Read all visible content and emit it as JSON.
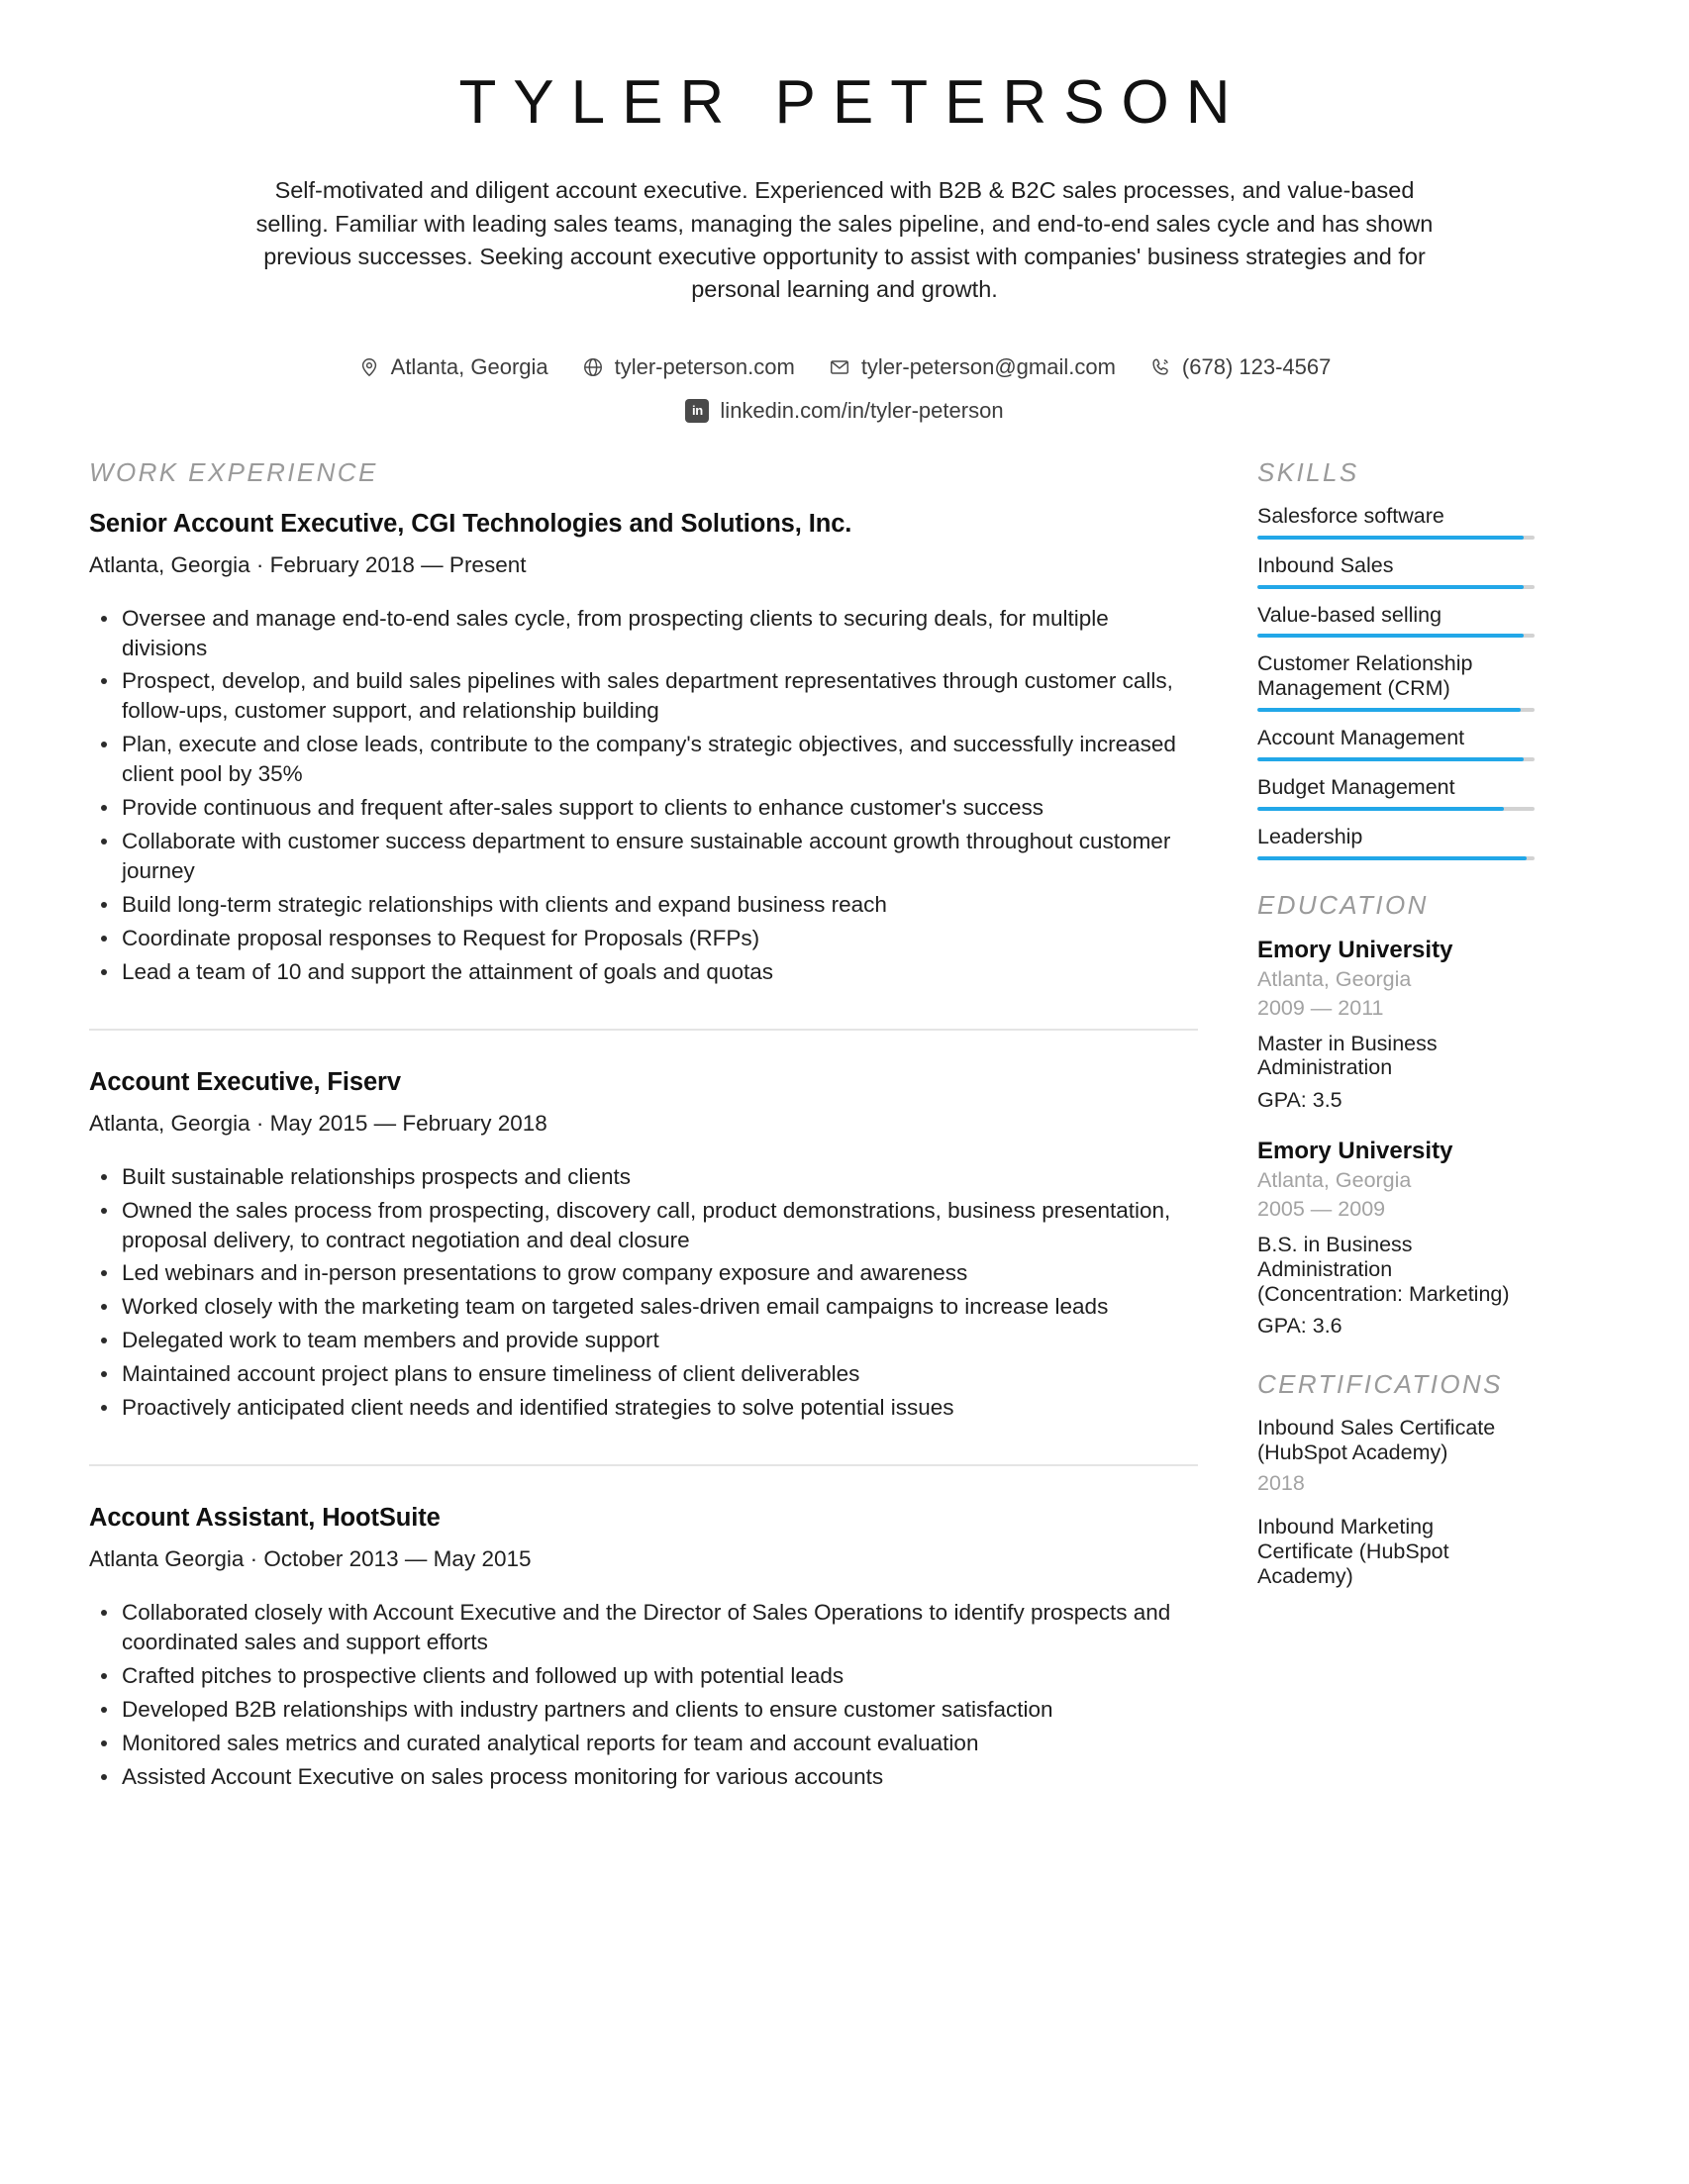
{
  "header": {
    "name": "TYLER PETERSON",
    "summary": "Self-motivated and diligent account executive. Experienced with B2B & B2C sales processes, and value-based selling. Familiar with leading sales teams, managing the sales pipeline, and end-to-end sales cycle and has shown previous successes. Seeking account executive opportunity to assist with companies' business strategies and for personal learning and growth.",
    "contacts": [
      {
        "icon": "location-pin-icon",
        "text": "Atlanta, Georgia"
      },
      {
        "icon": "globe-icon",
        "text": "tyler-peterson.com"
      },
      {
        "icon": "envelope-icon",
        "text": "tyler-peterson@gmail.com"
      },
      {
        "icon": "phone-icon",
        "text": "(678) 123-4567"
      }
    ],
    "linkedin": {
      "icon": "linkedin-icon",
      "badge": "in",
      "text": "linkedin.com/in/tyler-peterson"
    }
  },
  "sections": {
    "work_experience": "WORK EXPERIENCE",
    "skills": "SKILLS",
    "education": "EDUCATION",
    "certifications": "CERTIFICATIONS"
  },
  "jobs": [
    {
      "title": "Senior Account Executive, CGI Technologies and Solutions, Inc.",
      "meta": "Atlanta, Georgia · February 2018 — Present",
      "bullets": [
        "Oversee and manage end-to-end sales cycle, from prospecting clients to securing deals, for multiple divisions",
        "Prospect, develop, and build sales pipelines with sales department representatives through customer calls, follow-ups, customer support, and relationship building",
        "Plan, execute and close leads, contribute to the company's strategic objectives, and successfully increased client pool by 35%",
        "Provide continuous and frequent after-sales support to clients to enhance customer's success",
        "Collaborate with customer success department to ensure sustainable account growth throughout customer journey",
        "Build long-term strategic relationships with clients and expand business reach",
        "Coordinate proposal responses to Request for Proposals (RFPs)",
        "Lead a team of 10 and support the attainment of goals and quotas"
      ]
    },
    {
      "title": "Account Executive, Fiserv",
      "meta": "Atlanta, Georgia · May 2015 — February 2018",
      "bullets": [
        "Built sustainable relationships prospects and clients",
        "Owned the sales process from prospecting, discovery call, product demonstrations, business presentation, proposal delivery, to contract negotiation and deal closure",
        "Led webinars and in-person presentations to grow company exposure and awareness",
        "Worked closely with the marketing team on targeted sales-driven email campaigns to increase leads",
        "Delegated work to team members and provide support",
        "Maintained account project plans to ensure timeliness of client deliverables",
        "Proactively anticipated client needs and identified strategies to solve potential issues"
      ]
    },
    {
      "title": "Account Assistant, HootSuite",
      "meta": "Atlanta Georgia · October 2013 — May 2015",
      "bullets": [
        "Collaborated closely with Account Executive and the Director of Sales Operations to identify prospects and coordinated sales and support efforts",
        "Crafted pitches to prospective clients and followed up with potential leads",
        "Developed B2B relationships with industry partners and clients to ensure customer satisfaction",
        "Monitored sales metrics and curated analytical reports for team and account evaluation",
        "Assisted Account Executive on sales process monitoring for various accounts"
      ]
    }
  ],
  "skills": [
    {
      "label": "Salesforce software",
      "level": 96
    },
    {
      "label": "Inbound Sales",
      "level": 96
    },
    {
      "label": "Value-based selling",
      "level": 96
    },
    {
      "label": "Customer Relationship Management (CRM)",
      "level": 95
    },
    {
      "label": "Account Management",
      "level": 96
    },
    {
      "label": "Budget Management",
      "level": 89
    },
    {
      "label": "Leadership",
      "level": 97
    }
  ],
  "education": [
    {
      "school": "Emory University",
      "location": "Atlanta, Georgia",
      "dates": "2009 — 2011",
      "degree": "Master in Business Administration",
      "gpa": "GPA: 3.5"
    },
    {
      "school": "Emory University",
      "location": "Atlanta, Georgia",
      "dates": "2005 — 2009",
      "degree": "B.S. in Business Administration (Concentration: Marketing)",
      "gpa": "GPA: 3.6"
    }
  ],
  "certifications": [
    {
      "name": "Inbound Sales Certificate (HubSpot Academy)",
      "year": "2018"
    },
    {
      "name": "Inbound Marketing Certificate (HubSpot Academy)",
      "year": ""
    }
  ],
  "colors": {
    "accent": "#22a7e8",
    "track": "#d2d2d2",
    "muted": "#a3a3a3",
    "section_title": "#9a9a9a"
  }
}
